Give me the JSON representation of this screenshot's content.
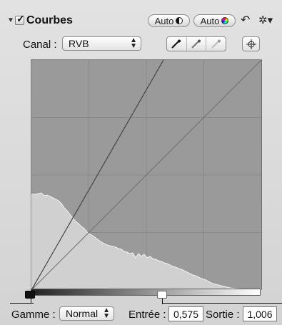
{
  "header": {
    "title": "Courbes",
    "enabled": true,
    "auto_contrast_label": "Auto",
    "auto_color_label": "Auto",
    "icons": [
      "disclosure-triangle-icon",
      "undo-arrow-icon",
      "gear-icon"
    ]
  },
  "channel": {
    "label": "Canal :",
    "selected": "RVB",
    "icons": [
      "black-point-eyedropper-icon",
      "gray-point-eyedropper-icon",
      "white-point-eyedropper-icon",
      "target-icon"
    ]
  },
  "curve": {
    "histogram_color": "#d0d0d0",
    "grid_color": "#8b8b8b",
    "background_color": "#9a9a9a",
    "curve_color": "#444444"
  },
  "controls": {
    "gamma_label": "Gamme :",
    "gamma_selected": "Normal",
    "input_label": "Entrée :",
    "input_value": "0,575",
    "output_label": "Sortie :",
    "output_value": "1,006"
  }
}
